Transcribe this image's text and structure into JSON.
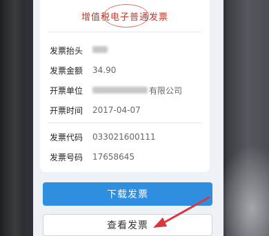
{
  "invoice": {
    "title": "增值税电子普通发票",
    "fields": {
      "header_label": "发票抬头",
      "amount_label": "发票金额",
      "amount_value": "34.90",
      "issuer_label": "开票单位",
      "issuer_value_suffix": "有限公司",
      "date_label": "开票时间",
      "date_value": "2017-04-07",
      "code_label": "发票代码",
      "code_value": "033021600111",
      "number_label": "发票号码",
      "number_value": "17658645"
    }
  },
  "actions": {
    "download_label": "下载发票",
    "view_label": "查看发票"
  },
  "colors": {
    "primary": "#2f8ee0",
    "title_red": "#c0392b",
    "annotation_arrow": "#d9363e"
  }
}
